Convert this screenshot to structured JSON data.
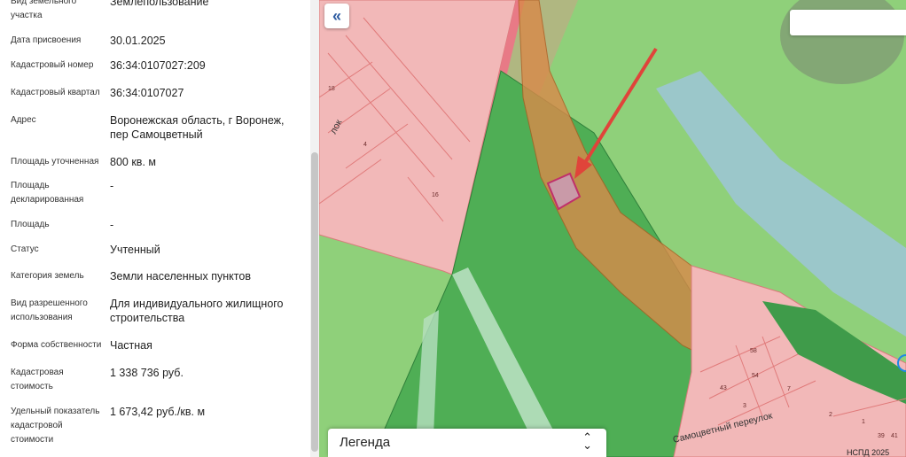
{
  "info": {
    "rows": [
      {
        "label": "Вид земельного участка",
        "value": "Землепользование"
      },
      {
        "label": "Дата присвоения",
        "value": "30.01.2025"
      },
      {
        "label": "Кадастровый номер",
        "value": "36:34:0107027:209"
      },
      {
        "label": "Кадастровый квартал",
        "value": "36:34:0107027"
      },
      {
        "label": "Адрес",
        "value": "Воронежская область, г Воронеж, пер Самоцветный"
      },
      {
        "label": "Площадь уточненная",
        "value": "800 кв. м"
      },
      {
        "label": "Площадь декларированная",
        "value": "-"
      },
      {
        "label": "Площадь",
        "value": "-"
      },
      {
        "label": "Статус",
        "value": "Учтенный"
      },
      {
        "label": "Категория земель",
        "value": "Земли населенных пунктов"
      },
      {
        "label": "Вид разрешенного использования",
        "value": "Для индивидуального жилищного строительства"
      },
      {
        "label": "Форма собственности",
        "value": "Частная"
      },
      {
        "label": "Кадастровая стоимость",
        "value": "1 338 736 руб."
      },
      {
        "label": "Удельный показатель кадастровой стоимости",
        "value": "1 673,42 руб./кв. м"
      }
    ]
  },
  "map": {
    "collapse_icon": "double-chevron-left-icon",
    "collapse_glyph": "«",
    "legend_label": "Легенда",
    "legend_icon": "chevron-up-down-icon",
    "street_label": "Самоцветный переулок",
    "street_label_upper": "лок",
    "copyright": "НСПД 2025",
    "house_numbers": [
      "18",
      "4",
      "16",
      "58",
      "54",
      "7",
      "43",
      "3",
      "2",
      "1",
      "39",
      "41"
    ],
    "colors": {
      "green_zone": "#58b85a",
      "light_green": "#8fd07a",
      "pink_zone": "#f2b8b8",
      "parcel_orange": "#d98a4a",
      "selected_parcel": "#c0306b",
      "arrow": "#e0443a",
      "water": "#9ec6d8"
    }
  }
}
